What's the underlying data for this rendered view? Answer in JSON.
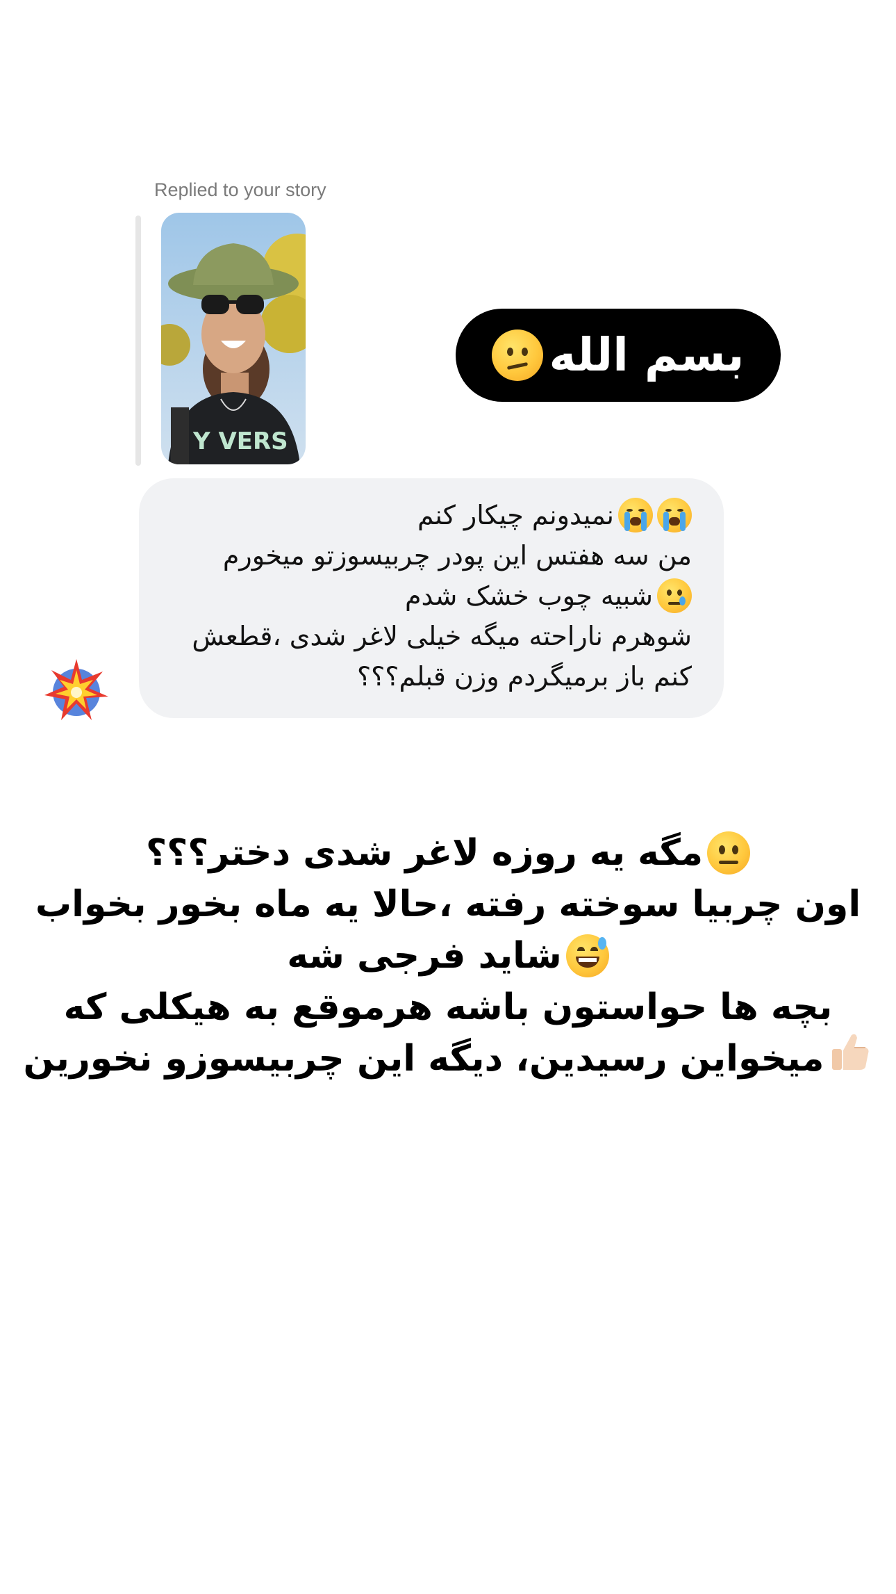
{
  "reply": {
    "label": "Replied to your story"
  },
  "sticker": {
    "text": "بسم الله",
    "emoji": "confused-face"
  },
  "message": {
    "lines": [
      {
        "text": "نمیدونم چیکار کنم",
        "emoji": "loudly-crying-face x2"
      },
      {
        "text": "من سه هفتس این پودر چربیسوزتو میخورم"
      },
      {
        "text": "شبیه چوب خشک شدم",
        "emoji": "crying-face"
      },
      {
        "text": "شوهرم ناراحته میگه خیلی لاغر شدی ،قطعش"
      },
      {
        "text": "کنم باز برمیگردم وزن قبلم؟؟؟"
      }
    ],
    "reaction": "collision-emoji"
  },
  "caption": {
    "lines": [
      {
        "text": "مگه یه روزه لاغر شدی دختر؟؟؟",
        "emoji": "neutral-face"
      },
      {
        "text": "اون چربیا سوخته رفته ،حالا یه ماه بخور بخواب"
      },
      {
        "text": "شاید فرجی شه",
        "emoji": "grinning-sweat-face"
      },
      {
        "text": "بچه ها حواستون باشه هرموقع به هیکلی که"
      },
      {
        "text": "میخواین رسیدین، دیگه این چربیسوزو نخورین",
        "emoji": "thumbs-up"
      }
    ]
  },
  "colors": {
    "background": "#ffffff",
    "bubble": "#f1f2f4",
    "sticker_bg": "#000000",
    "reply_label": "#7a7a7a"
  }
}
